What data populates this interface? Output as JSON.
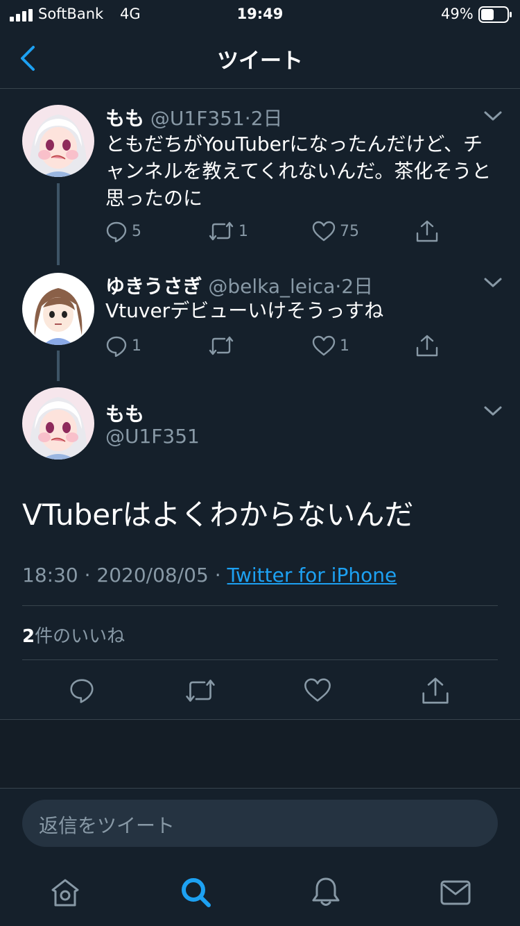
{
  "status_bar": {
    "carrier": "SoftBank",
    "network": "4G",
    "time": "19:49",
    "battery": "49%"
  },
  "header": {
    "title": "ツイート",
    "back_icon": "chevron-left-icon"
  },
  "thread": [
    {
      "name": "もも",
      "handle": "@U1F351",
      "sep": "·",
      "time": "2日",
      "text": "ともだちがYouTuberになったんだけど、チャンネルを教えてくれないんだ。茶化そうと思ったのに",
      "reply_count": "5",
      "retweet_count": "1",
      "like_count": "75"
    },
    {
      "name": "ゆきうさぎ",
      "handle": "@belka_leica",
      "sep": "·",
      "time": "2日",
      "text": "Vtuverデビューいけそうっすね",
      "reply_count": "1",
      "retweet_count": "",
      "like_count": "1"
    }
  ],
  "main_tweet": {
    "name": "もも",
    "handle": "@U1F351",
    "text": "VTuberはよくわからないんだ",
    "time": "18:30",
    "sep1": "·",
    "date": "2020/08/05",
    "sep2": "·",
    "source": "Twitter for iPhone",
    "likes_count": "2",
    "likes_label": "件のいいね"
  },
  "reply": {
    "placeholder": "返信をツイート"
  },
  "colors": {
    "background": "#15202b",
    "accent": "#1da1f2",
    "muted": "#8899a6",
    "divider": "#38444d"
  },
  "tabs": [
    "home-icon",
    "search-icon",
    "bell-icon",
    "mail-icon"
  ]
}
